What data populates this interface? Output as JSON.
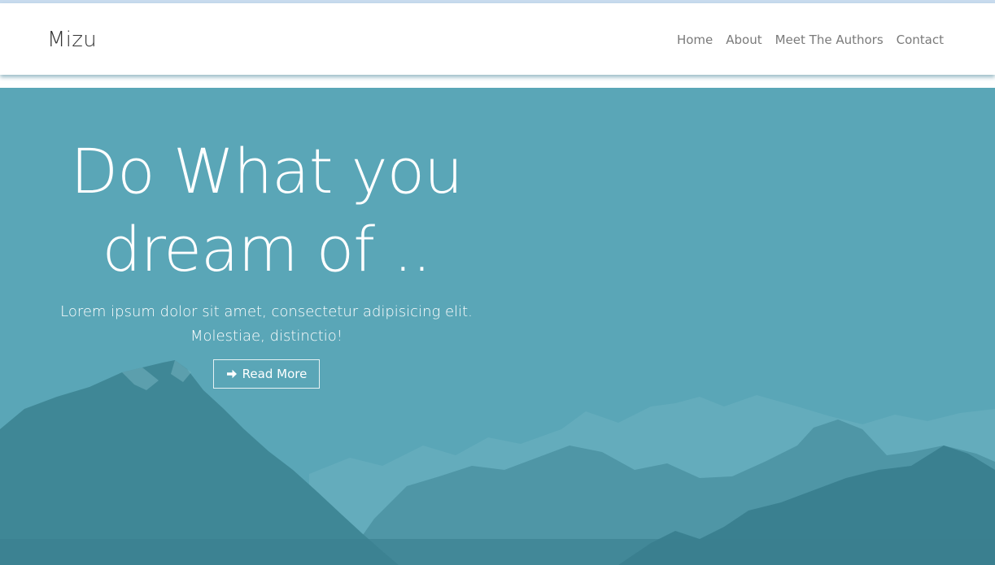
{
  "navbar": {
    "brand": "Mizu",
    "links": [
      {
        "label": "Home"
      },
      {
        "label": "About"
      },
      {
        "label": "Meet The Authors"
      },
      {
        "label": "Contact"
      }
    ]
  },
  "hero": {
    "headline": "Do What you dream of ..",
    "subtext": "Lorem ipsum dolor sit amet, consectetur adipisicing elit. Molestiae, distinctio!",
    "button": {
      "label": "Read More",
      "icon": "arrow-right-icon"
    }
  },
  "colors": {
    "hero_overlay": "#5aa6b7",
    "mountains": "#3f8796",
    "text_light": "#ffffff",
    "nav_text": "#7a7a7a",
    "brand_text": "#333333"
  }
}
